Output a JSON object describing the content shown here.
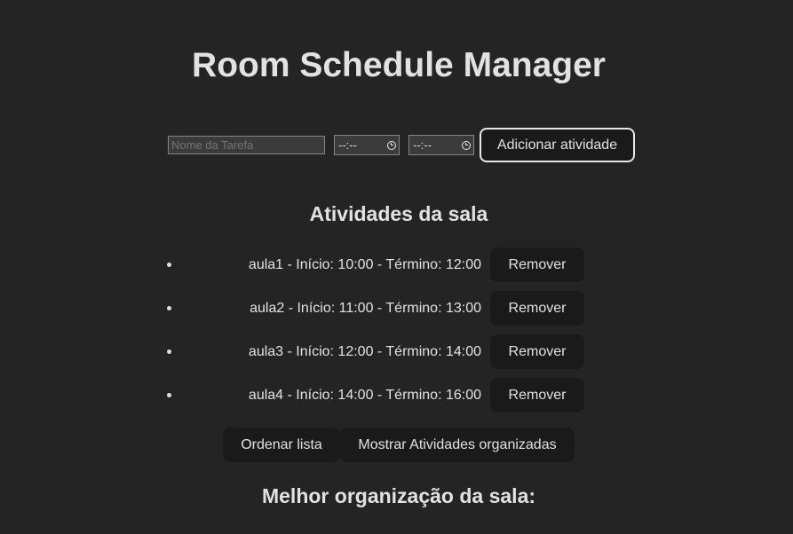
{
  "header": {
    "title": "Room Schedule Manager"
  },
  "form": {
    "task_placeholder": "Nome da Tarefa",
    "start_time_value": "--:--",
    "end_time_value": "--:--",
    "add_button_label": "Adicionar atividade"
  },
  "activities": {
    "heading": "Atividades da sala",
    "items": [
      {
        "text": "aula1 - Início: 10:00 - Término: 12:00",
        "remove_label": "Remover"
      },
      {
        "text": "aula2 - Início: 11:00 - Término: 13:00",
        "remove_label": "Remover"
      },
      {
        "text": "aula3 - Início: 12:00 - Término: 14:00",
        "remove_label": "Remover"
      },
      {
        "text": "aula4 - Início: 14:00 - Término: 16:00",
        "remove_label": "Remover"
      }
    ]
  },
  "actions": {
    "sort_label": "Ordenar lista",
    "show_label": "Mostrar Atividades organizadas"
  },
  "best": {
    "heading": "Melhor organização da sala:"
  },
  "colors": {
    "background": "#242424",
    "button": "#1a1a1a",
    "text": "#dedede"
  }
}
